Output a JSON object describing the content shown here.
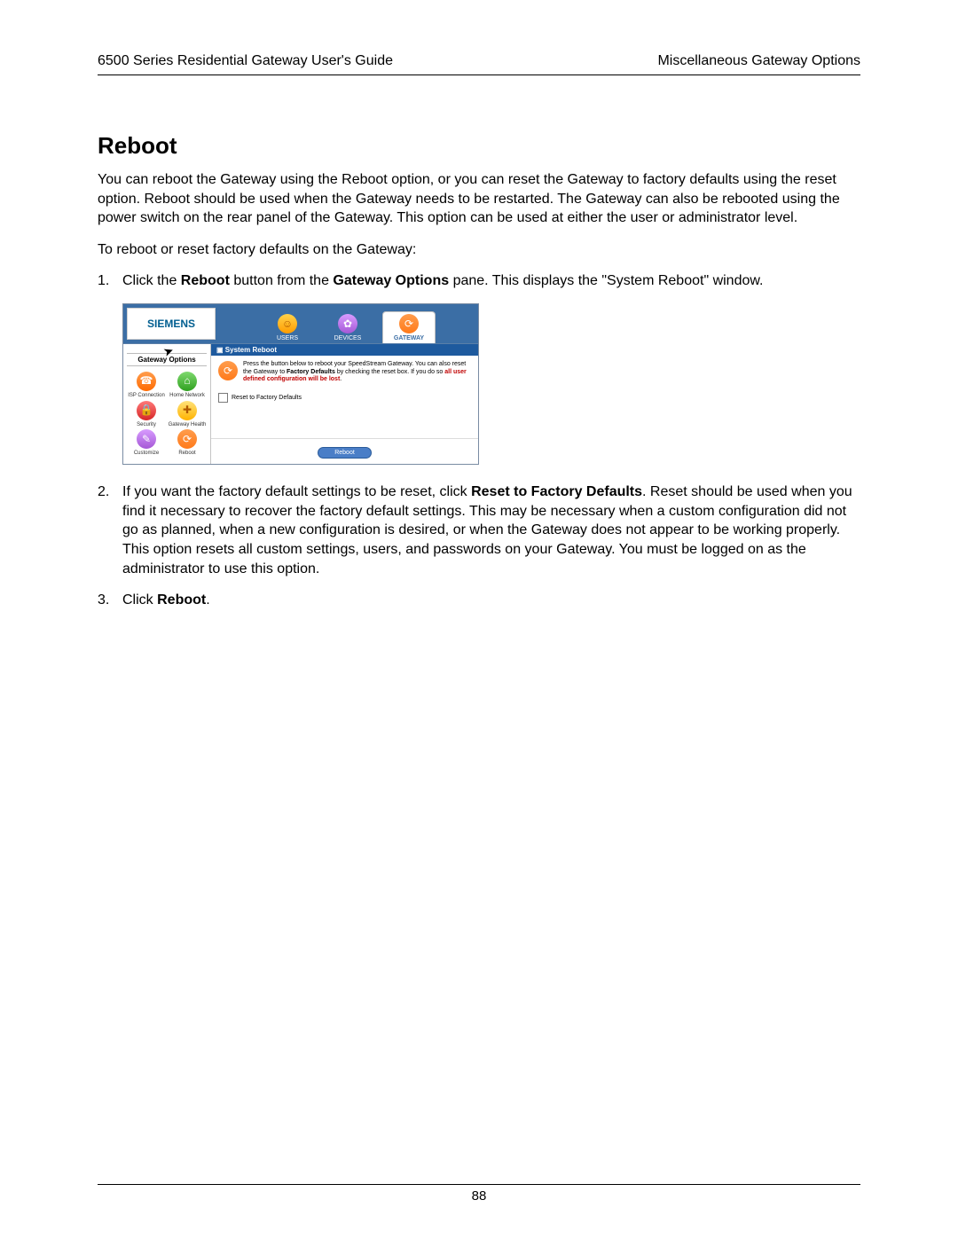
{
  "header": {
    "left": "6500 Series Residential Gateway User's Guide",
    "right": "Miscellaneous Gateway Options"
  },
  "title": "Reboot",
  "intro": "You can reboot the Gateway using the Reboot option, or you can reset the Gateway to factory defaults using the reset option. Reboot should be used when the Gateway needs to be restarted. The Gateway can also be rebooted using the power switch on the rear panel of the Gateway. This option can be used at either the user or administrator level.",
  "lead": "To reboot or reset factory defaults on the Gateway:",
  "step1_pre": "Click the ",
  "step1_b1": "Reboot",
  "step1_mid": " button from the ",
  "step1_b2": "Gateway Options",
  "step1_post": " pane. This displays the \"System Reboot\" window.",
  "step2_pre": "If you want the factory default settings to be reset, click ",
  "step2_b": "Reset to Factory Defaults",
  "step2_post": ". Reset should be used when you find it necessary to recover the factory default settings. This may be necessary when a custom configuration did not go as planned, when a new configuration is desired, or when the Gateway does not appear to be working properly. This option resets all custom settings, users, and passwords on your Gateway. You must be logged on as the administrator to use this option.",
  "step3_pre": "Click ",
  "step3_b": "Reboot",
  "step3_post": ".",
  "shot": {
    "logo": "SIEMENS",
    "tabs": {
      "users": "USERS",
      "devices": "DEVICES",
      "gateway": "GATEWAY"
    },
    "side_title": "Gateway Options",
    "side_items": [
      {
        "label": "ISP Connection"
      },
      {
        "label": "Home Network"
      },
      {
        "label": "Security"
      },
      {
        "label": "Gateway Health"
      },
      {
        "label": "Customize"
      },
      {
        "label": "Reboot"
      }
    ],
    "panel_header": "System Reboot",
    "panel_text1": "Press the button below to reboot your SpeedStream Gateway. You can also reset the Gateway to ",
    "panel_bold1": "Factory Defaults",
    "panel_text2": " by checking the reset box. If you do so ",
    "panel_red": "all user defined configuration will be lost",
    "panel_text3": ".",
    "checkbox": "Reset to Factory Defaults",
    "reboot_btn": "Reboot"
  },
  "page_number": "88"
}
